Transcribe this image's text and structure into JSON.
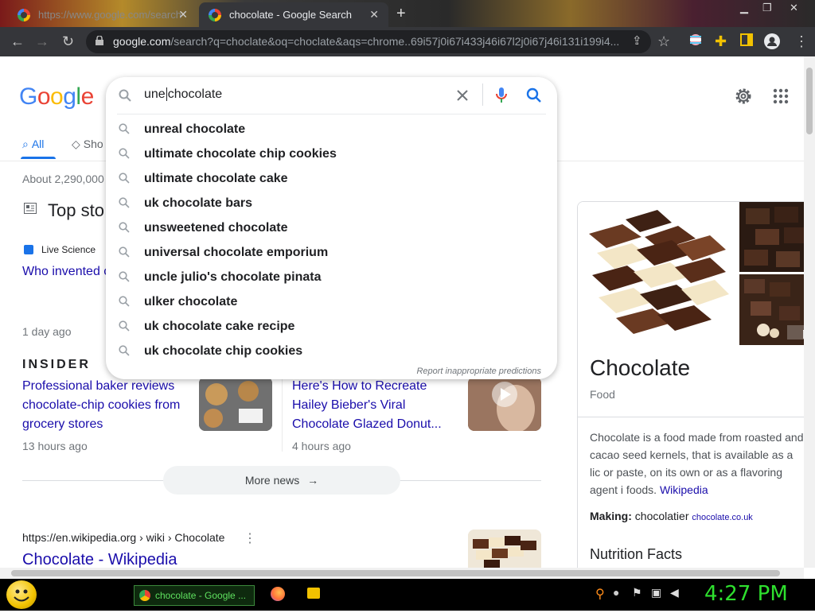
{
  "browser": {
    "tabs": [
      {
        "label": "https://www.google.com/search"
      },
      {
        "label": "chocolate - Google Search"
      }
    ],
    "new_tab": "+",
    "url_domain": "google.com",
    "url_rest": "/search?q=choclate&oq=choclate&aqs=chrome..69i57j0i67i433j46i67l2j0i67j46i131i199i4..."
  },
  "search": {
    "query_prefix": "une",
    "query": "chocolate",
    "suggestions": [
      "unreal chocolate",
      "ultimate chocolate chip cookies",
      "ultimate chocolate cake",
      "uk chocolate bars",
      "unsweetened chocolate",
      "universal chocolate emporium",
      "uncle julio's chocolate pinata",
      "ulker chocolate",
      "uk chocolate cake recipe",
      "uk chocolate chip cookies"
    ],
    "report": "Report inappropriate predictions"
  },
  "logo": [
    "G",
    "o",
    "o",
    "g",
    "l",
    "e"
  ],
  "nav": {
    "all": "All",
    "shopping": "Sho"
  },
  "results": {
    "stats": "About 2,290,000",
    "top_stories": "Top sto",
    "story1_source": "Live Science",
    "story1_title": "Who invented c",
    "story1_time": "1 day ago",
    "story2_source": "INSIDER",
    "story2_title": "Professional baker reviews chocolate-chip cookies from grocery stores",
    "story2_time": "13 hours ago",
    "story3_title": "Here's How to Recreate Hailey Bieber's Viral Chocolate Glazed Donut...",
    "story3_time": "4 hours ago",
    "more_news": "More news",
    "wiki_url": "https://en.wikipedia.org › wiki › Chocolate",
    "wiki_title": "Chocolate - Wikipedia"
  },
  "knowledge_panel": {
    "title": "Chocolate",
    "subtitle": "Food",
    "description": "Chocolate is a food made from roasted and cacao seed kernels, that is available as a lic or paste, on its own or as a flavoring agent i foods.",
    "description_link": "Wikipedia",
    "making_label": "Making:",
    "making_value": "chocolatier",
    "making_source": "chocolate.co.uk",
    "nutrition": "Nutrition Facts"
  },
  "taskbar": {
    "chrome_label": "chocolate - Google ...",
    "clock": "4:27 PM"
  },
  "colors": {
    "link": "#1a0dab",
    "accent": "#1a73e8",
    "clock": "#2ee02e"
  }
}
